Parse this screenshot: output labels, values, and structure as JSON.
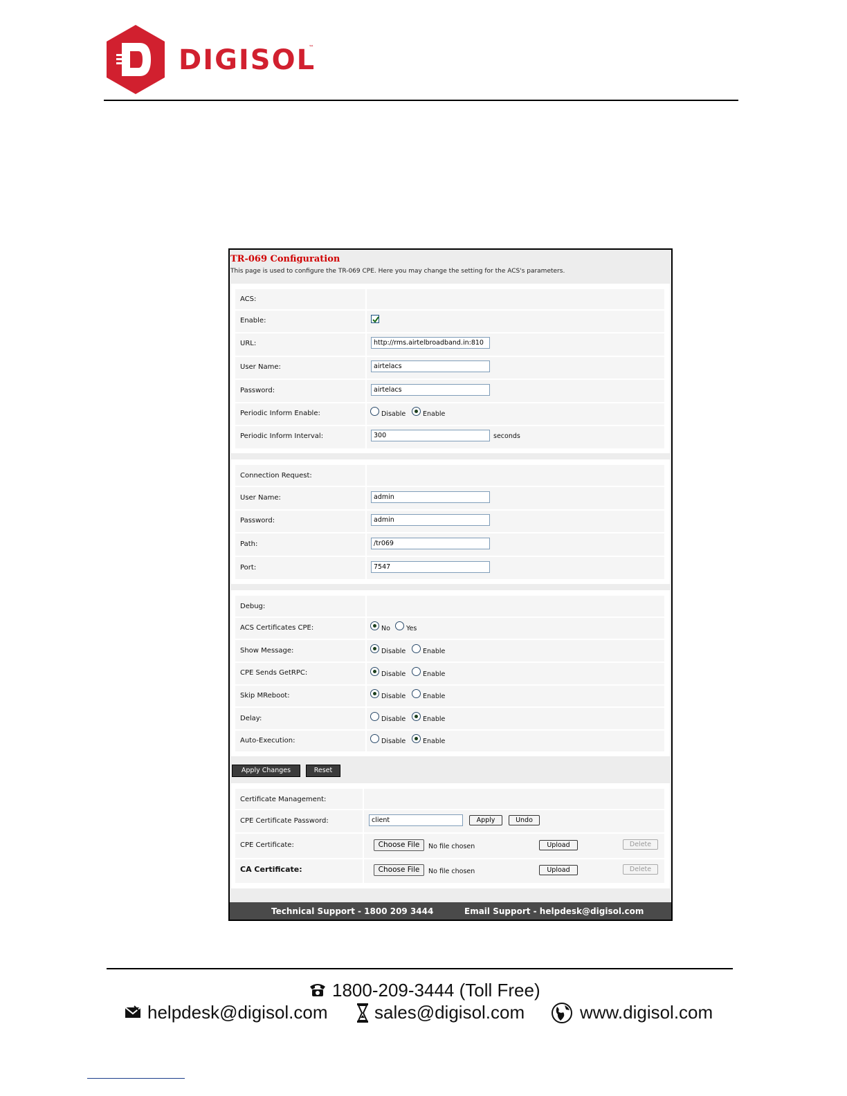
{
  "brand": {
    "name": "DIGISOL",
    "tm": "™",
    "red": "#d1202f"
  },
  "page": {
    "title": "TR-069 Configuration",
    "description": "This page is used to configure the TR-069 CPE. Here you may change the setting for the ACS's parameters."
  },
  "acs": {
    "header": "ACS:",
    "enable_label": "Enable:",
    "enable_checked": true,
    "url_label": "URL:",
    "url_value": "http://rms.airtelbroadband.in:810",
    "username_label": "User Name:",
    "username_value": "airtelacs",
    "password_label": "Password:",
    "password_value": "airtelacs",
    "periodic_enable_label": "Periodic Inform Enable:",
    "periodic_enable_value": "Enable",
    "periodic_interval_label": "Periodic Inform Interval:",
    "periodic_interval_value": "300",
    "seconds": "seconds"
  },
  "connection": {
    "header": "Connection Request:",
    "username_label": "User Name:",
    "username_value": "admin",
    "password_label": "Password:",
    "password_value": "admin",
    "path_label": "Path:",
    "path_value": "/tr069",
    "port_label": "Port:",
    "port_value": "7547"
  },
  "debug": {
    "header": "Debug:",
    "rows": [
      {
        "label": "ACS Certificates CPE:",
        "opt1": "No",
        "opt2": "Yes",
        "selected": 1
      },
      {
        "label": "Show Message:",
        "opt1": "Disable",
        "opt2": "Enable",
        "selected": 1
      },
      {
        "label": "CPE Sends GetRPC:",
        "opt1": "Disable",
        "opt2": "Enable",
        "selected": 1
      },
      {
        "label": "Skip MReboot:",
        "opt1": "Disable",
        "opt2": "Enable",
        "selected": 1
      },
      {
        "label": "Delay:",
        "opt1": "Disable",
        "opt2": "Enable",
        "selected": 2
      },
      {
        "label": "Auto-Execution:",
        "opt1": "Disable",
        "opt2": "Enable",
        "selected": 2
      }
    ]
  },
  "actions": {
    "apply": "Apply Changes",
    "reset": "Reset"
  },
  "certificates": {
    "header": "Certificate Management:",
    "password_label": "CPE Certificate Password:",
    "password_value": "client",
    "apply": "Apply",
    "undo": "Undo",
    "cpe_label": "CPE Certificate:",
    "ca_label": "CA Certificate:",
    "choose_file": "Choose File",
    "no_file": "No file chosen",
    "upload": "Upload",
    "delete": "Delete"
  },
  "support": {
    "technical": "Technical Support - 1800 209 3444",
    "email": "Email Support - helpdesk@digisol.com"
  },
  "footer": {
    "phone": "1800-209-3444 (Toll Free)",
    "helpdesk": "helpdesk@digisol.com",
    "sales": "sales@digisol.com",
    "website": "www.digisol.com"
  }
}
